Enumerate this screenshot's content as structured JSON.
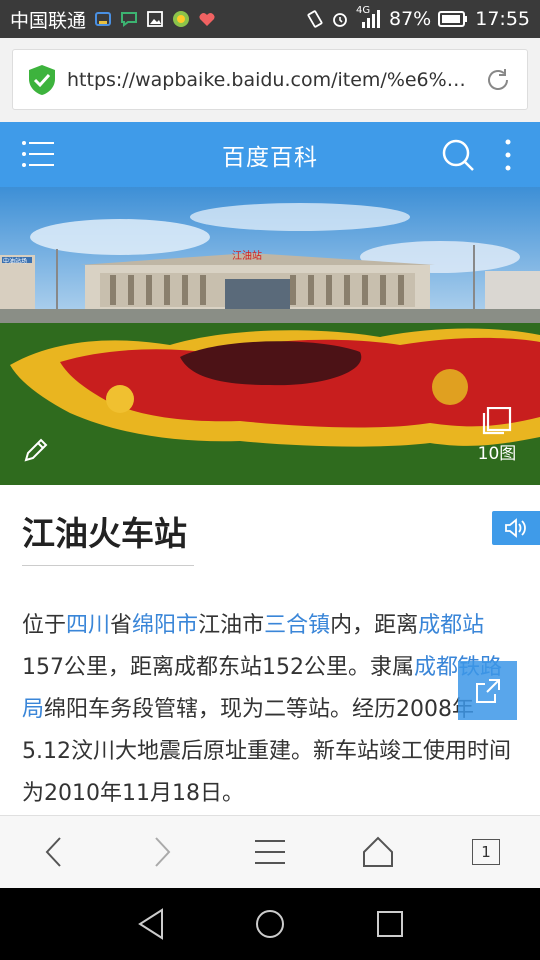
{
  "status_bar": {
    "carrier": "中国联通",
    "network": "4G",
    "battery": "87%",
    "time": "17:55"
  },
  "browser": {
    "url": "https://wapbaike.baidu.com/item/%e6%b...",
    "tab_count": "1"
  },
  "header": {
    "title": "百度百科"
  },
  "hero": {
    "image_count_label": "10图",
    "station_sign": "江油站",
    "sign_left": "中油站场"
  },
  "article": {
    "title": "江油火车站",
    "para_segments": [
      {
        "text": "位于",
        "link": false
      },
      {
        "text": "四川",
        "link": true
      },
      {
        "text": "省",
        "link": false
      },
      {
        "text": "绵阳市",
        "link": true
      },
      {
        "text": "江油市",
        "link": false
      },
      {
        "text": "三合镇",
        "link": true
      },
      {
        "text": "内，距离",
        "link": false
      },
      {
        "text": "成都站",
        "link": true
      },
      {
        "text": "157公里，距离成都东站152公里。隶属",
        "link": false
      },
      {
        "text": "成都铁路局",
        "link": true
      },
      {
        "text": "绵阳车务段管辖，现为二等站。经历2008年5.12汶川大地震后原址重建。新车站竣工使用时间为2010年11月18日。",
        "link": false
      }
    ]
  },
  "colors": {
    "brand_blue": "#3f9be9",
    "link_blue": "#3a86d8",
    "status_bar": "#3a3a3a"
  },
  "icons": [
    "shield-check-icon",
    "reload-icon",
    "menu-icon",
    "search-icon",
    "more-vertical-icon",
    "pencil-icon",
    "gallery-icon",
    "speaker-icon",
    "share-icon",
    "back-icon",
    "forward-icon",
    "menu-lines-icon",
    "home-icon",
    "nav-back-icon",
    "nav-home-icon",
    "nav-recents-icon"
  ]
}
